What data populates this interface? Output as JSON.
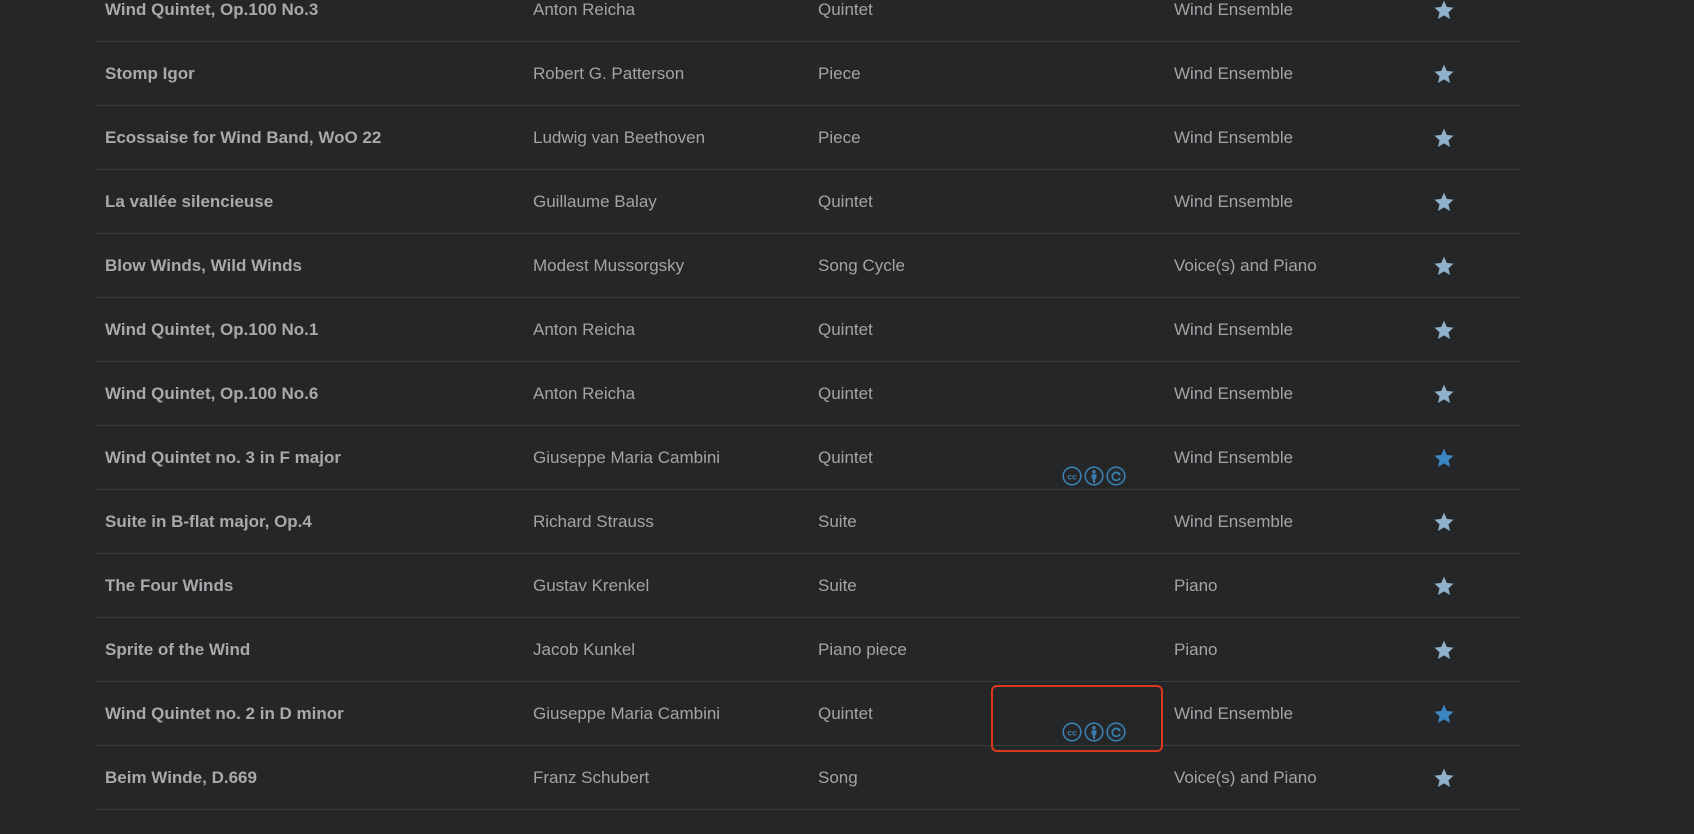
{
  "colors": {
    "background": "#252628",
    "divider": "#3a3b3d",
    "text": "#a2a4a6",
    "title_text": "#a7a9ab",
    "star_inactive": "#8fb0c9",
    "star_active": "#3a85c2",
    "cc_icon": "#3a7fae",
    "highlight": "#d93a1e"
  },
  "rows": [
    {
      "title": "Wind Quintet, Op.100 No.3",
      "composer": "Anton Reicha",
      "form": "Quintet",
      "license": false,
      "instrumentation": "Wind Ensemble",
      "favorite": false
    },
    {
      "title": "Stomp Igor",
      "composer": "Robert G. Patterson",
      "form": "Piece",
      "license": false,
      "instrumentation": "Wind Ensemble",
      "favorite": false
    },
    {
      "title": "Ecossaise for Wind Band, WoO 22",
      "composer": "Ludwig van Beethoven",
      "form": "Piece",
      "license": false,
      "instrumentation": "Wind Ensemble",
      "favorite": false
    },
    {
      "title": "La vallée silencieuse",
      "composer": "Guillaume Balay",
      "form": "Quintet",
      "license": false,
      "instrumentation": "Wind Ensemble",
      "favorite": false
    },
    {
      "title": "Blow Winds, Wild Winds",
      "composer": "Modest Mussorgsky",
      "form": "Song Cycle",
      "license": false,
      "instrumentation": "Voice(s) and Piano",
      "favorite": false
    },
    {
      "title": "Wind Quintet, Op.100 No.1",
      "composer": "Anton Reicha",
      "form": "Quintet",
      "license": false,
      "instrumentation": "Wind Ensemble",
      "favorite": false
    },
    {
      "title": "Wind Quintet, Op.100 No.6",
      "composer": "Anton Reicha",
      "form": "Quintet",
      "license": false,
      "instrumentation": "Wind Ensemble",
      "favorite": false
    },
    {
      "title": "Wind Quintet no. 3 in F major",
      "composer": "Giuseppe Maria Cambini",
      "form": "Quintet",
      "license": true,
      "instrumentation": "Wind Ensemble",
      "favorite": true
    },
    {
      "title": "Suite in B-flat major, Op.4",
      "composer": "Richard Strauss",
      "form": "Suite",
      "license": false,
      "instrumentation": "Wind Ensemble",
      "favorite": false
    },
    {
      "title": "The Four Winds",
      "composer": "Gustav Krenkel",
      "form": "Suite",
      "license": false,
      "instrumentation": "Piano",
      "favorite": false
    },
    {
      "title": "Sprite of the Wind",
      "composer": "Jacob Kunkel",
      "form": "Piano piece",
      "license": false,
      "instrumentation": "Piano",
      "favorite": false
    },
    {
      "title": "Wind Quintet no. 2 in D minor",
      "composer": "Giuseppe Maria Cambini",
      "form": "Quintet",
      "license": true,
      "instrumentation": "Wind Ensemble",
      "favorite": true
    },
    {
      "title": "Beim Winde, D.669",
      "composer": "Franz Schubert",
      "form": "Song",
      "license": false,
      "instrumentation": "Voice(s) and Piano",
      "favorite": false
    }
  ],
  "license_icons": [
    "cc-icon",
    "by-attribution-icon",
    "sa-share-alike-icon"
  ]
}
